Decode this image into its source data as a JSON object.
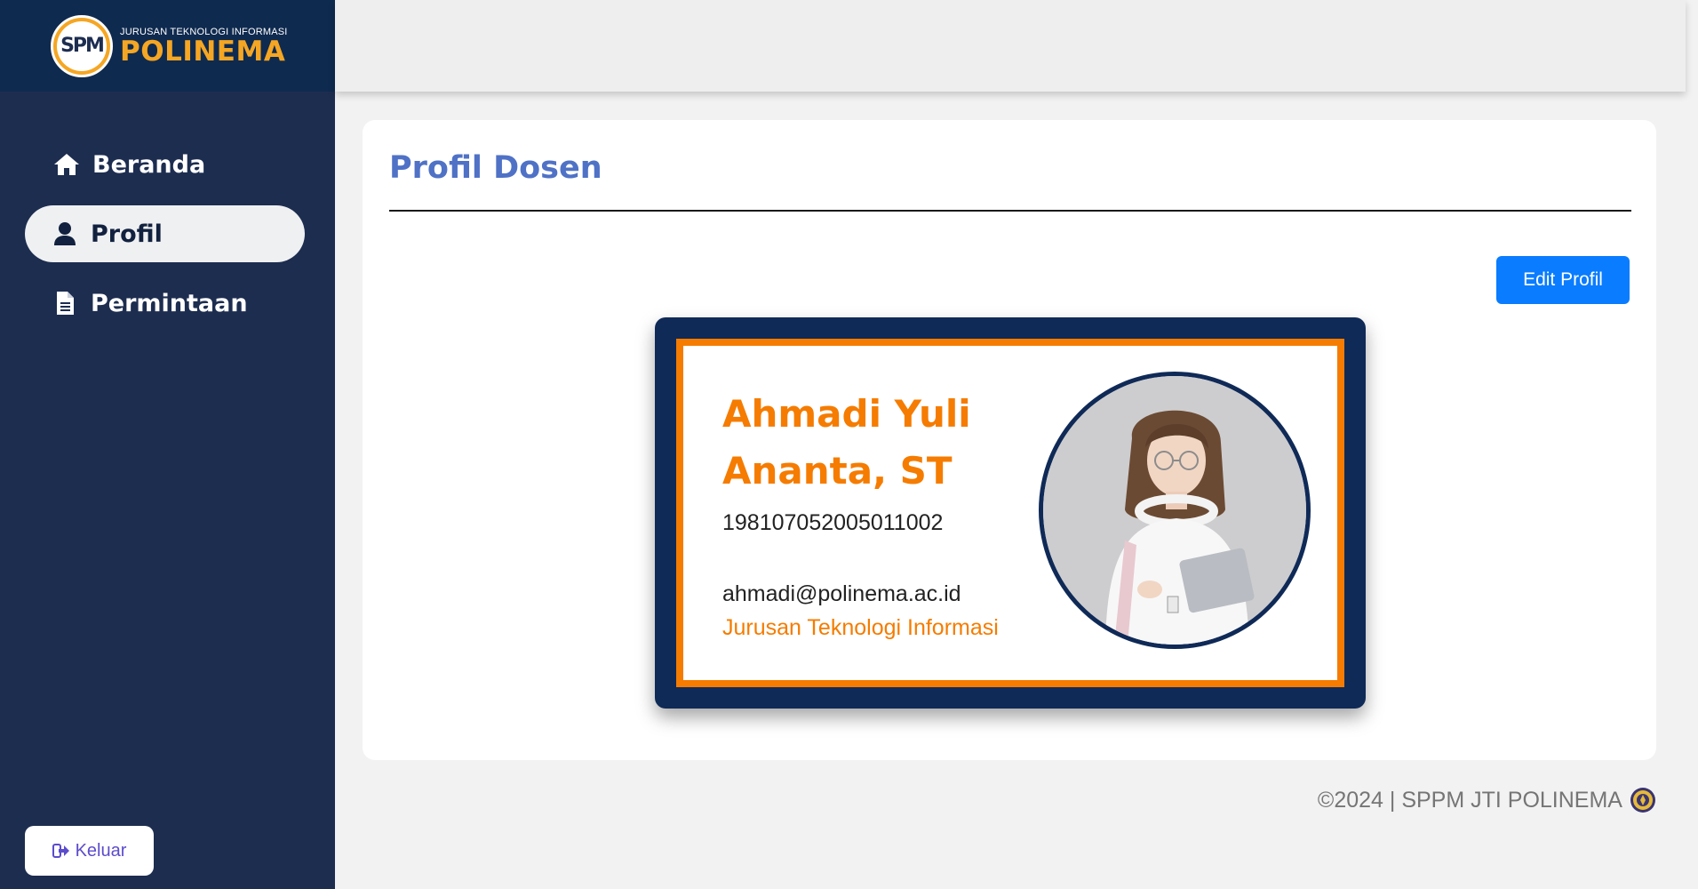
{
  "brand": {
    "badge_text": "SPM",
    "subtitle": "JURUSAN TEKNOLOGI INFORMASI",
    "title": "POLINEMA"
  },
  "sidebar": {
    "items": [
      {
        "label": "Beranda",
        "icon": "home-icon",
        "active": false
      },
      {
        "label": "Profil",
        "icon": "user-icon",
        "active": true
      },
      {
        "label": "Permintaan",
        "icon": "document-icon",
        "active": false
      }
    ],
    "logout_label": "Keluar"
  },
  "main": {
    "title": "Profil Dosen",
    "edit_button": "Edit Profil"
  },
  "profile": {
    "name": "Ahmadi Yuli Ananta, ST",
    "nip": "198107052005011002",
    "email": "ahmadi@polinema.ac.id",
    "department": "Jurusan Teknologi Informasi"
  },
  "footer": {
    "text": "©2024 | SPPM JTI POLINEMA"
  },
  "colors": {
    "sidebar_bg": "#1d2d50",
    "accent_orange": "#f57c00",
    "card_navy": "#0f2a57",
    "title_blue": "#4f72c6",
    "button_blue": "#0a7cff"
  }
}
